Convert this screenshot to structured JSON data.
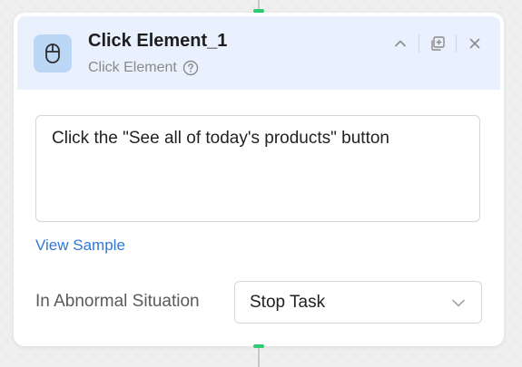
{
  "node": {
    "title": "Click Element_1",
    "type_label": "Click Element",
    "icon": "mouse-icon",
    "actions": [
      "chevron-up-icon",
      "duplicate-icon",
      "close-icon"
    ]
  },
  "description": {
    "text": "Click the \"See all of today's products\" button"
  },
  "links": {
    "view_sample": "View Sample"
  },
  "abnormal": {
    "label": "In Abnormal Situation",
    "selected": "Stop Task"
  },
  "colors": {
    "header_bg": "#e8f1fd",
    "icon_bg": "#bcd6f6",
    "link": "#2f78d6",
    "connector": "#2ecc71"
  }
}
